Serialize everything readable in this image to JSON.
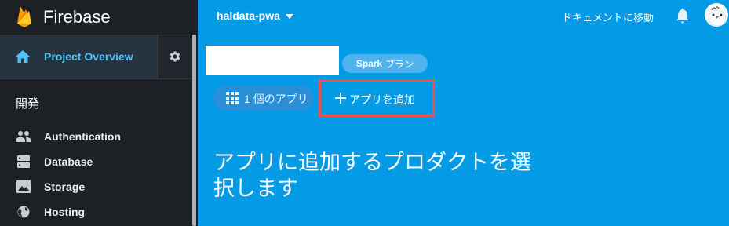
{
  "sidebar": {
    "brand": "Firebase",
    "overview": "Project Overview",
    "section": "開発",
    "items": [
      {
        "label": "Authentication",
        "icon": "people-icon"
      },
      {
        "label": "Database",
        "icon": "database-icon"
      },
      {
        "label": "Storage",
        "icon": "image-icon"
      },
      {
        "label": "Hosting",
        "icon": "globe-icon"
      }
    ]
  },
  "topbar": {
    "project": "haldata-pwa",
    "docs": "ドキュメントに移動"
  },
  "main": {
    "plan_name": "Spark",
    "plan_suffix": "プラン",
    "apps_count": "1 個のアプリ",
    "add_app": "アプリを追加",
    "heading": "アプリに追加するプロダクトを選択します"
  },
  "colors": {
    "background": "#039be5",
    "sidebar": "#1d2125",
    "accent": "#4fc3f7",
    "highlight_box": "#e45454"
  }
}
